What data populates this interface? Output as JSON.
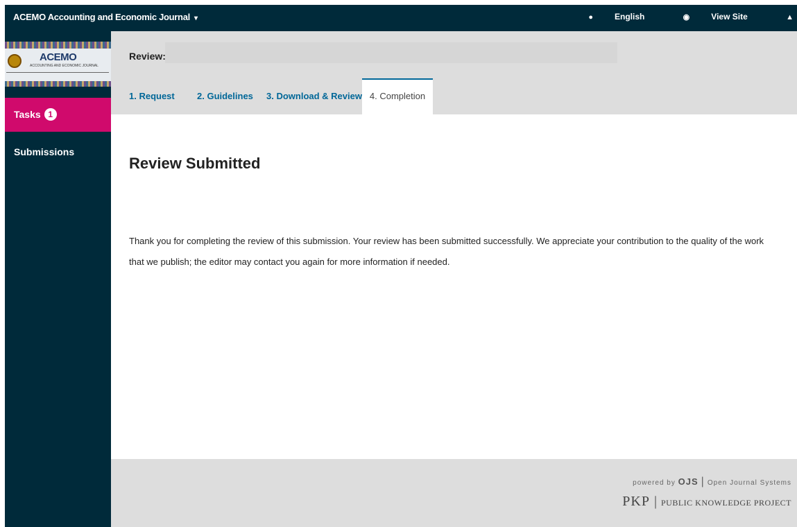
{
  "topbar": {
    "journal_title": "ACEMO Accounting and Economic Journal",
    "caret": "▾",
    "language": "English",
    "view_site": "View Site"
  },
  "logo": {
    "title": "ACEMO",
    "subtitle": "ACCOUNTING AND ECONOMIC JOURNAL"
  },
  "sidebar": {
    "tasks_label": "Tasks",
    "tasks_count": "1",
    "submissions_label": "Submissions"
  },
  "header": {
    "review_label": "Review:",
    "review_title": ""
  },
  "tabs": [
    {
      "label": "1. Request"
    },
    {
      "label": "2. Guidelines"
    },
    {
      "label": "3. Download & Review"
    },
    {
      "label": "4. Completion"
    }
  ],
  "main": {
    "heading": "Review Submitted",
    "line1": "Thank you for completing the review of this submission. Your review has been submitted successfully. We appreciate your contribution to the quality of the work",
    "line2": "that we publish; the editor may contact you again for more information if needed."
  },
  "footer": {
    "powered_by": "powered by",
    "ojs": "OJS",
    "ojs_full": "Open Journal Systems",
    "pkp": "PKP",
    "pkp_full": "PUBLIC KNOWLEDGE PROJECT"
  },
  "colors": {
    "topbar": "#002a3a",
    "accent": "#d00a6c",
    "link": "#006798"
  },
  "icons": [
    "chevron-down-icon",
    "globe-icon",
    "eye-icon",
    "user-icon"
  ]
}
